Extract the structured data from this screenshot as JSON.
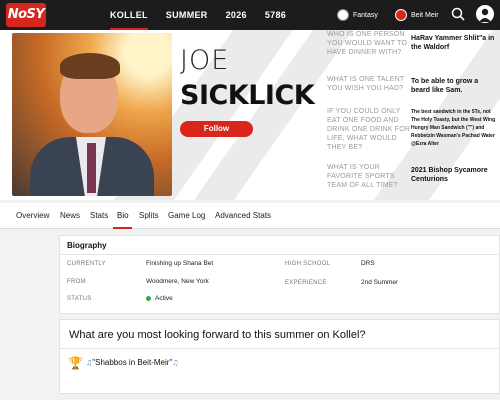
{
  "nav": {
    "logo": "NoSY",
    "links": [
      "KOLLEL",
      "SUMMER",
      "2026",
      "5786"
    ],
    "fantasy_label": "Fantasy",
    "location_label": "Beit Meir"
  },
  "player": {
    "first_name": "JOE",
    "last_name": "SICKLICK",
    "follow_label": "Follow"
  },
  "qa": [
    {
      "question": "WHO IS ONE PERSON YOU WOULD WANT TO HAVE DINNER WITH?",
      "answer": "HaRav Yammer Shlit\"a in the Waldorf"
    },
    {
      "question": "WHAT IS ONE TALENT YOU WISH YOU HAD?",
      "answer": "To be able to grow a beard like Sam."
    },
    {
      "question": "IF YOU COULD ONLY EAT ONE FOOD AND DRINK ONE DRINK FOR LIFE, WHAT WOULD THEY BE?",
      "answer": "The best sandwich in the 5Ts, not The Holy Toasty, but the West Wing Hungry Man Sandwich (\"\") and Rebbetzin Waxman's Pachad Water @Ezra Alter"
    },
    {
      "question": "WHAT IS YOUR FAVORITE SPORTS TEAM OF ALL TIME?",
      "answer": "2021 Bishop Sycamore Centurions"
    }
  ],
  "tabs": [
    "Overview",
    "News",
    "Stats",
    "Bio",
    "Splits",
    "Game Log",
    "Advanced Stats"
  ],
  "active_tab": "Bio",
  "biography": {
    "title": "Biography",
    "currently_label": "CURRENTLY",
    "currently": "Finishing up Shana Bet",
    "from_label": "FROM",
    "from": "Woodmere, New York",
    "status_label": "STATUS",
    "status": "Active",
    "high_school_label": "HIGH SCHOOL",
    "high_school": "DRS",
    "experience_label": "EXPERIENCE",
    "experience": "2nd Summer"
  },
  "looking_forward": {
    "question": "What are you most looking forward to this summer on Kollel?",
    "answer": "\"Shabbos in Beit-Meir\""
  },
  "colors": {
    "accent": "#d9261c",
    "nav_bg": "#1c1c1c",
    "status_active": "#3aa343"
  }
}
